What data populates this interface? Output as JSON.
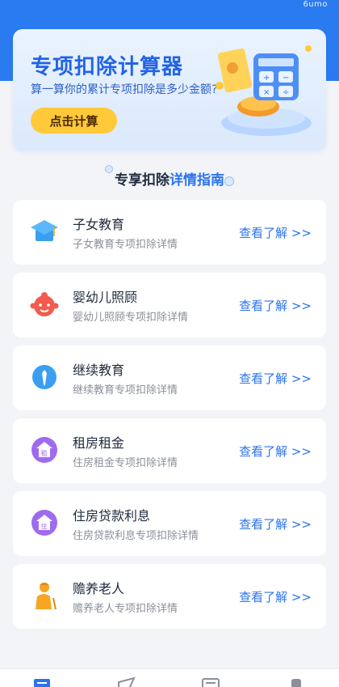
{
  "status": {
    "watermark": "6umo"
  },
  "banner": {
    "title": "专项扣除计算器",
    "subtitle": "算一算你的累计专项扣除是多少金额?",
    "button_label": "点击计算"
  },
  "section": {
    "heading_prefix": "专享扣除",
    "heading_highlight": "详情指南"
  },
  "items": [
    {
      "title": "子女教育",
      "desc": "子女教育专项扣除详情",
      "link": "查看了解 >>",
      "icon": "graduation-cap-icon"
    },
    {
      "title": "婴幼儿照顾",
      "desc": "婴幼儿照顾专项扣除详情",
      "link": "查看了解 >>",
      "icon": "baby-face-icon"
    },
    {
      "title": "继续教育",
      "desc": "继续教育专项扣除详情",
      "link": "查看了解 >>",
      "icon": "person-tie-icon"
    },
    {
      "title": "租房租金",
      "desc": "住房租金专项扣除详情",
      "link": "查看了解 >>",
      "icon": "rent-house-icon"
    },
    {
      "title": "住房贷款利息",
      "desc": "住房贷款利息专项扣除详情",
      "link": "查看了解 >>",
      "icon": "loan-house-icon"
    },
    {
      "title": "赡养老人",
      "desc": "赡养老人专项扣除详情",
      "link": "查看了解 >>",
      "icon": "elderly-person-icon"
    }
  ],
  "tabbar": {
    "tabs": [
      "home-tab-icon",
      "send-tab-icon",
      "document-tab-icon",
      "profile-tab-icon"
    ]
  },
  "colors": {
    "primary": "#2a7bf0",
    "accent": "#ffc93a",
    "link": "#2b73ee"
  }
}
